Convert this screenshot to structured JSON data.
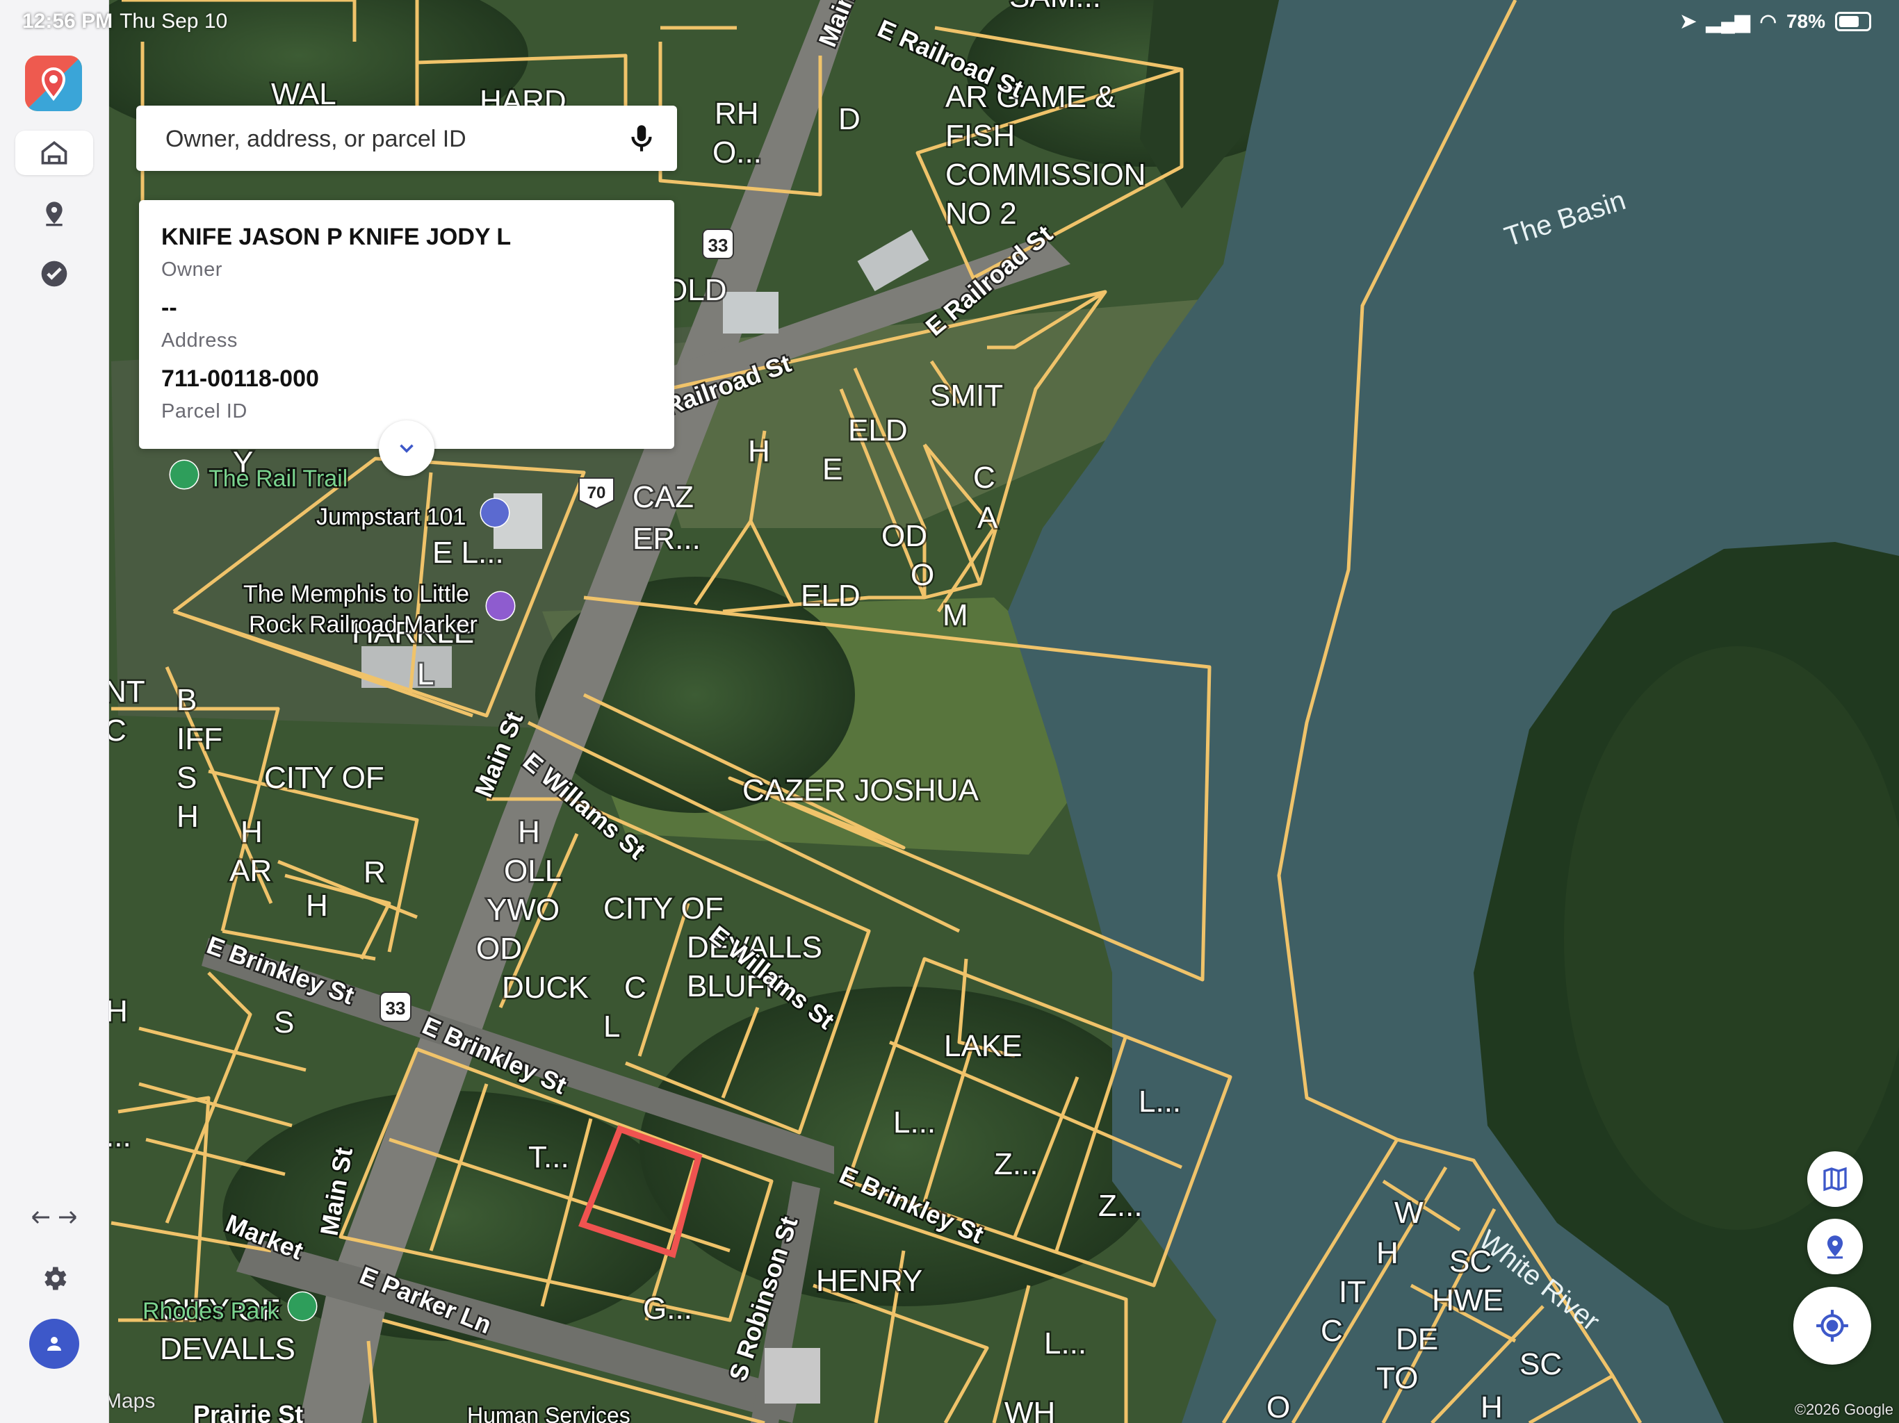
{
  "status_bar": {
    "time": "12:56 PM",
    "date": "Thu Sep 10",
    "battery": "78%"
  },
  "sidebar": {
    "items": [
      {
        "name": "home",
        "icon": "home-icon",
        "active": true
      },
      {
        "name": "places",
        "icon": "map-pin-icon",
        "active": false
      },
      {
        "name": "tasks",
        "icon": "check-circle-icon",
        "active": false
      }
    ],
    "bottom": [
      {
        "name": "expand",
        "icon": "arrows-left-right-icon"
      },
      {
        "name": "settings",
        "icon": "gear-icon"
      },
      {
        "name": "account",
        "icon": "user-icon"
      }
    ]
  },
  "search": {
    "placeholder": "Owner, address, or parcel ID",
    "value": ""
  },
  "parcel_card": {
    "owner_value": "KNIFE JASON P KNIFE JODY L",
    "owner_label": "Owner",
    "address_value": "--",
    "address_label": "Address",
    "parcel_value": "711-00118-000",
    "parcel_label": "Parcel ID"
  },
  "map": {
    "parcel_labels": [
      "WAL",
      "HARD",
      "RH",
      "O...",
      "D",
      "AR GAME &",
      "FISH",
      "COMMISSION",
      "NO 2",
      "OLD",
      "SMIT",
      "ELD",
      "E",
      "H",
      "C",
      "A",
      "OD",
      "O",
      "M",
      "ELD",
      "CAZ",
      "ER...",
      "E L...",
      "HARKLE",
      "L",
      "NT",
      "C",
      "B",
      "IFF",
      "S",
      "H",
      "CITY OF",
      "H",
      "AR",
      "R",
      "H",
      "CAZER JOSHUA",
      "H",
      "OLL",
      "YWO",
      "OD",
      "DUCK",
      "CITY OF",
      "DEVALLS",
      "BLUFF",
      "C",
      "L",
      "S",
      "LAKE",
      "L...",
      "L...",
      "Z...",
      "Z...",
      "T...",
      "G...",
      "HENRY",
      "L...",
      "WH",
      "W",
      "H",
      "SC",
      "HWE",
      "IT",
      "C",
      "DE",
      "TO",
      "SC",
      "H",
      "O",
      "CITY OF",
      "DEVALLS",
      "Y",
      "H",
      "...",
      "SAM..."
    ],
    "street_labels": [
      "Main St",
      "E Railroad St",
      "E Railroad St",
      "Railroad St",
      "E Willams St",
      "E Willams St",
      "E Brinkley St",
      "E Brinkley St",
      "E Brinkley St",
      "Main St",
      "Main St",
      "Market",
      "E Parker Ln",
      "S Robinson St",
      "Prairie St",
      "Human Services"
    ],
    "poi_labels": [
      "The Rail Trail",
      "Jumpstart 101",
      "The Memphis to Little",
      "Rock Railroad Marker",
      "Rhodes Park"
    ],
    "water_labels": [
      "The Basin",
      "White River"
    ],
    "route_shields": [
      "33",
      "70",
      "33"
    ],
    "accent_color": "#f0c36a",
    "selected_color": "#ef5350",
    "google_label": "Maps",
    "copyright": "©2026 Google"
  },
  "controls": {
    "layers_icon": "map-icon",
    "pin_icon": "map-pin-icon",
    "locate_icon": "crosshair-icon",
    "collapse_icon": "chevron-down-icon"
  }
}
